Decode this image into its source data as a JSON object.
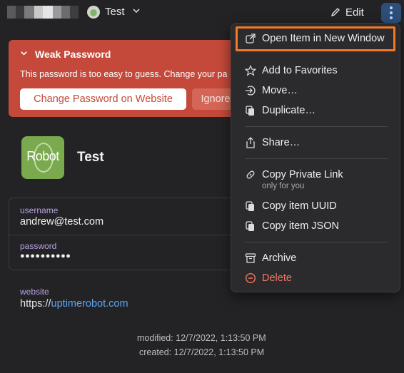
{
  "header": {
    "vault_name": "Test",
    "edit_label": "Edit"
  },
  "warning": {
    "title": "Weak Password",
    "message": "This password is too easy to guess. Change your pa",
    "change_button": "Change Password on Website",
    "ignore_button": "Ignore"
  },
  "item": {
    "logo_text": "Robot",
    "title": "Test",
    "fields": [
      {
        "label": "username",
        "value": "andrew@test.com"
      },
      {
        "label": "password",
        "value": "●●●●●●●●●●"
      }
    ],
    "website": {
      "label": "website",
      "prefix": "https://",
      "link": "uptimerobot.com"
    },
    "modified": "modified: 12/7/2022, 1:13:50 PM",
    "created": "created: 12/7/2022, 1:13:50 PM"
  },
  "menu": {
    "items": [
      {
        "label": "Open Item in New Window",
        "icon": "open-external-icon"
      },
      {
        "label": "Add to Favorites",
        "icon": "star-icon"
      },
      {
        "label": "Move…",
        "icon": "move-icon"
      },
      {
        "label": "Duplicate…",
        "icon": "duplicate-icon"
      },
      {
        "label": "Share…",
        "icon": "share-icon"
      },
      {
        "label": "Copy Private Link",
        "sublabel": "only for you",
        "icon": "link-icon"
      },
      {
        "label": "Copy item UUID",
        "icon": "copy-icon"
      },
      {
        "label": "Copy item JSON",
        "icon": "copy-icon"
      },
      {
        "label": "Archive",
        "icon": "archive-icon"
      },
      {
        "label": "Delete",
        "icon": "delete-icon"
      }
    ]
  },
  "colors": {
    "background": "#232325",
    "warning": "#c4493a",
    "accent_link": "#5aa7f2",
    "field_label": "#b7a2e2",
    "highlight": "#f47a25",
    "danger": "#f07862"
  }
}
